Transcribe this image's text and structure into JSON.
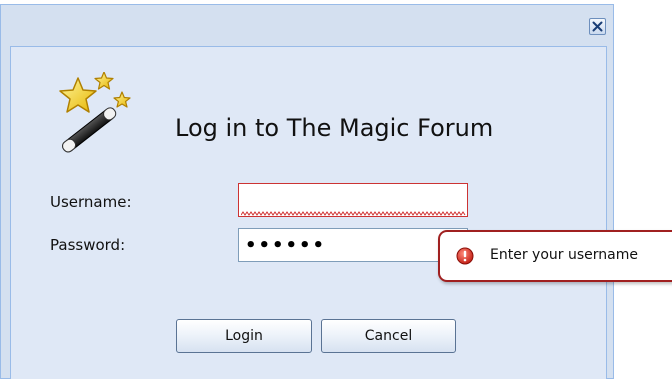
{
  "dialog": {
    "title": "Log in to The Magic Forum",
    "close_label": "×"
  },
  "form": {
    "username_label": "Username:",
    "username_value": "",
    "password_label": "Password:",
    "password_value": "••••••"
  },
  "validation": {
    "message": "Enter your username",
    "status_color": "#a02020"
  },
  "buttons": {
    "login_label": "Login",
    "cancel_label": "Cancel"
  },
  "icons": {
    "logo": "magic-wand-icon",
    "close": "close-icon",
    "error": "error-icon"
  },
  "colors": {
    "dialog_border": "#99bbe8",
    "dialog_bg": "#dfe8f6",
    "invalid_border": "#cc3333"
  }
}
